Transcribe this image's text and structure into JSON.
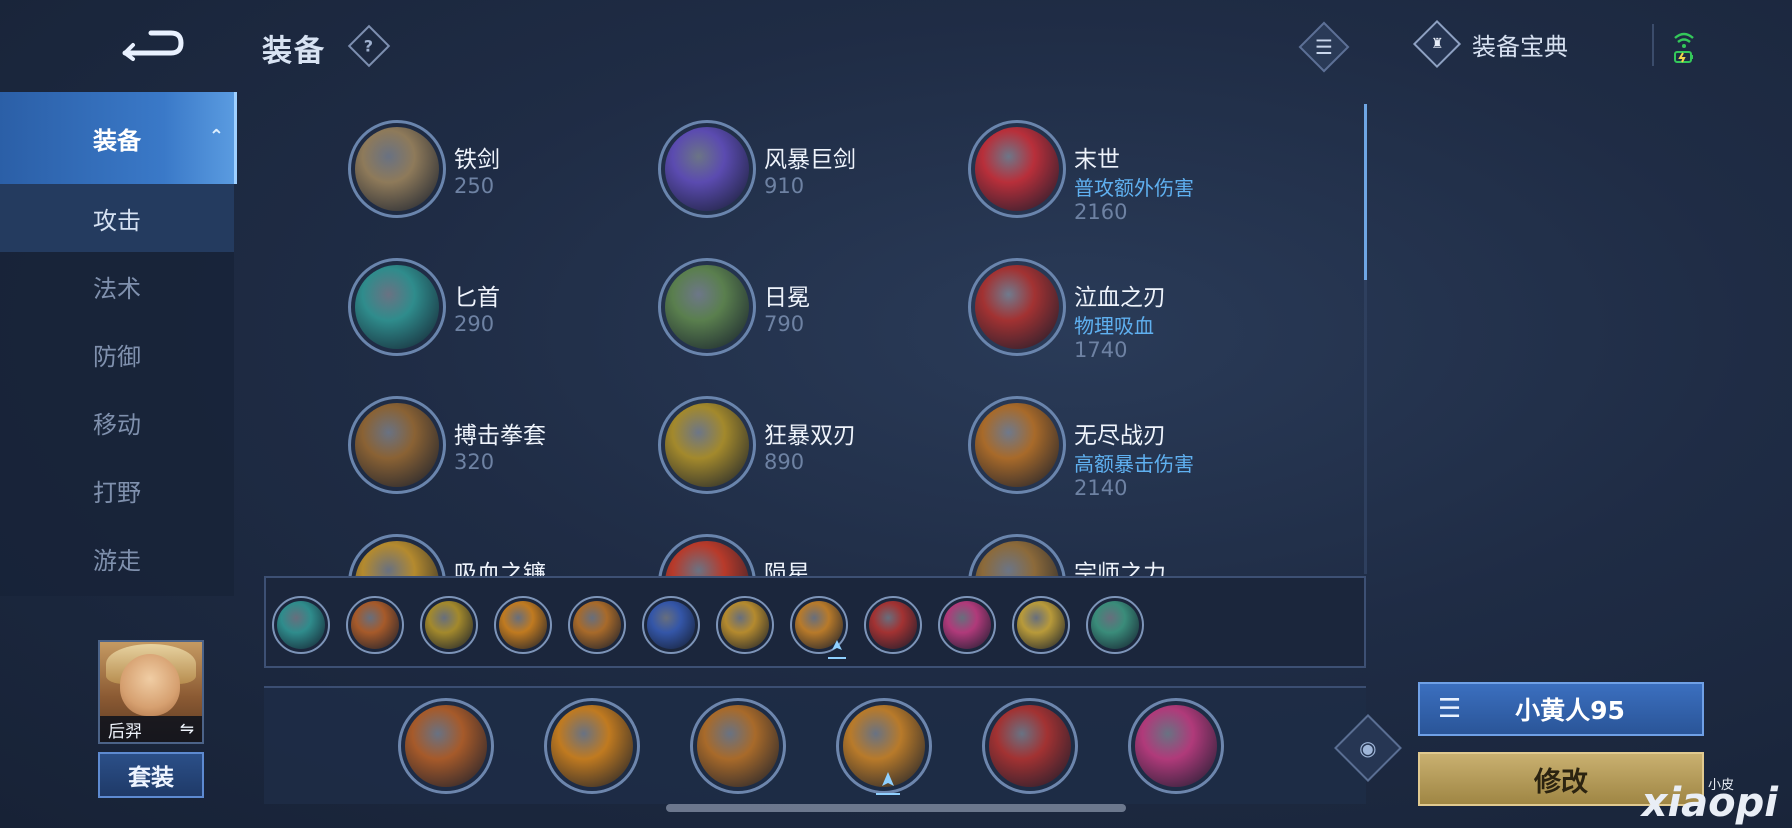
{
  "header": {
    "title": "装备",
    "help_label": "?",
    "codex_label": "装备宝典",
    "list_glyph": "☰"
  },
  "sidebar": {
    "items": [
      {
        "label": "装备"
      },
      {
        "label": "攻击"
      },
      {
        "label": "法术"
      },
      {
        "label": "防御"
      },
      {
        "label": "移动"
      },
      {
        "label": "打野"
      },
      {
        "label": "游走"
      }
    ]
  },
  "hero": {
    "name": "后羿",
    "swap_glyph": "⇋",
    "set_button": "套装"
  },
  "items": [
    {
      "name": "铁剑",
      "price": "250",
      "tag": "",
      "icon": "iron-sword",
      "color": "#8e7a5a"
    },
    {
      "name": "风暴巨剑",
      "price": "910",
      "tag": "",
      "icon": "storm-greatsword",
      "color": "#5b4bb0"
    },
    {
      "name": "末世",
      "price": "2160",
      "tag": "普攻额外伤害",
      "icon": "doomsday",
      "color": "#b82f3a"
    },
    {
      "name": "匕首",
      "price": "290",
      "tag": "",
      "icon": "dagger",
      "color": "#2f8c8c"
    },
    {
      "name": "日冕",
      "price": "790",
      "tag": "",
      "icon": "corona",
      "color": "#5a7f4e"
    },
    {
      "name": "泣血之刃",
      "price": "1740",
      "tag": "物理吸血",
      "icon": "bloodweep-blade",
      "color": "#a23232"
    },
    {
      "name": "搏击拳套",
      "price": "320",
      "tag": "",
      "icon": "fighting-gauntlet",
      "color": "#8a6234"
    },
    {
      "name": "狂暴双刃",
      "price": "890",
      "tag": "",
      "icon": "berserk-blades",
      "color": "#a3892c"
    },
    {
      "name": "无尽战刃",
      "price": "2140",
      "tag": "高额暴击伤害",
      "icon": "infinity-edge",
      "color": "#a86a2a"
    },
    {
      "name": "吸血之镰",
      "price": "",
      "tag": "",
      "icon": "vampire-scythe",
      "color": "#b48a2e"
    },
    {
      "name": "陨星",
      "price": "",
      "tag": "",
      "icon": "meteor",
      "color": "#b83a2a"
    },
    {
      "name": "宗师之力",
      "price": "",
      "tag": "",
      "icon": "master-power",
      "color": "#8c6a3a"
    }
  ],
  "recommended": [
    {
      "icon": "dagger",
      "color": "#2f8c8c"
    },
    {
      "icon": "boots",
      "color": "#a65a2a"
    },
    {
      "icon": "berserk-blades",
      "color": "#a3892c"
    },
    {
      "icon": "golden-blade",
      "color": "#c07a20"
    },
    {
      "icon": "infinity-edge",
      "color": "#a86a2a"
    },
    {
      "icon": "storm-blade",
      "color": "#3456a8"
    },
    {
      "icon": "scythe",
      "color": "#b48a2e"
    },
    {
      "icon": "golden-crossbow",
      "color": "#b87a2a"
    },
    {
      "icon": "bloodweep-blade",
      "color": "#a23232"
    },
    {
      "icon": "pink-blade",
      "color": "#b03a7a"
    },
    {
      "icon": "golden-armor",
      "color": "#b89a3a"
    },
    {
      "icon": "green-boots",
      "color": "#3a8c7a"
    }
  ],
  "build": [
    {
      "icon": "boots",
      "color": "#a65a2a"
    },
    {
      "icon": "golden-blade",
      "color": "#c07a20"
    },
    {
      "icon": "infinity-edge",
      "color": "#a86a2a"
    },
    {
      "icon": "golden-crossbow",
      "color": "#b87a2a"
    },
    {
      "icon": "bloodweep-blade",
      "color": "#a23232"
    },
    {
      "icon": "pink-blade",
      "color": "#b03a7a"
    }
  ],
  "plan": {
    "label": "小黄人95",
    "edit_label": "修改",
    "list_glyph": "☰"
  },
  "eye_glyph": "◉",
  "watermark": {
    "text": "xiaopi",
    "small": "小皮"
  }
}
